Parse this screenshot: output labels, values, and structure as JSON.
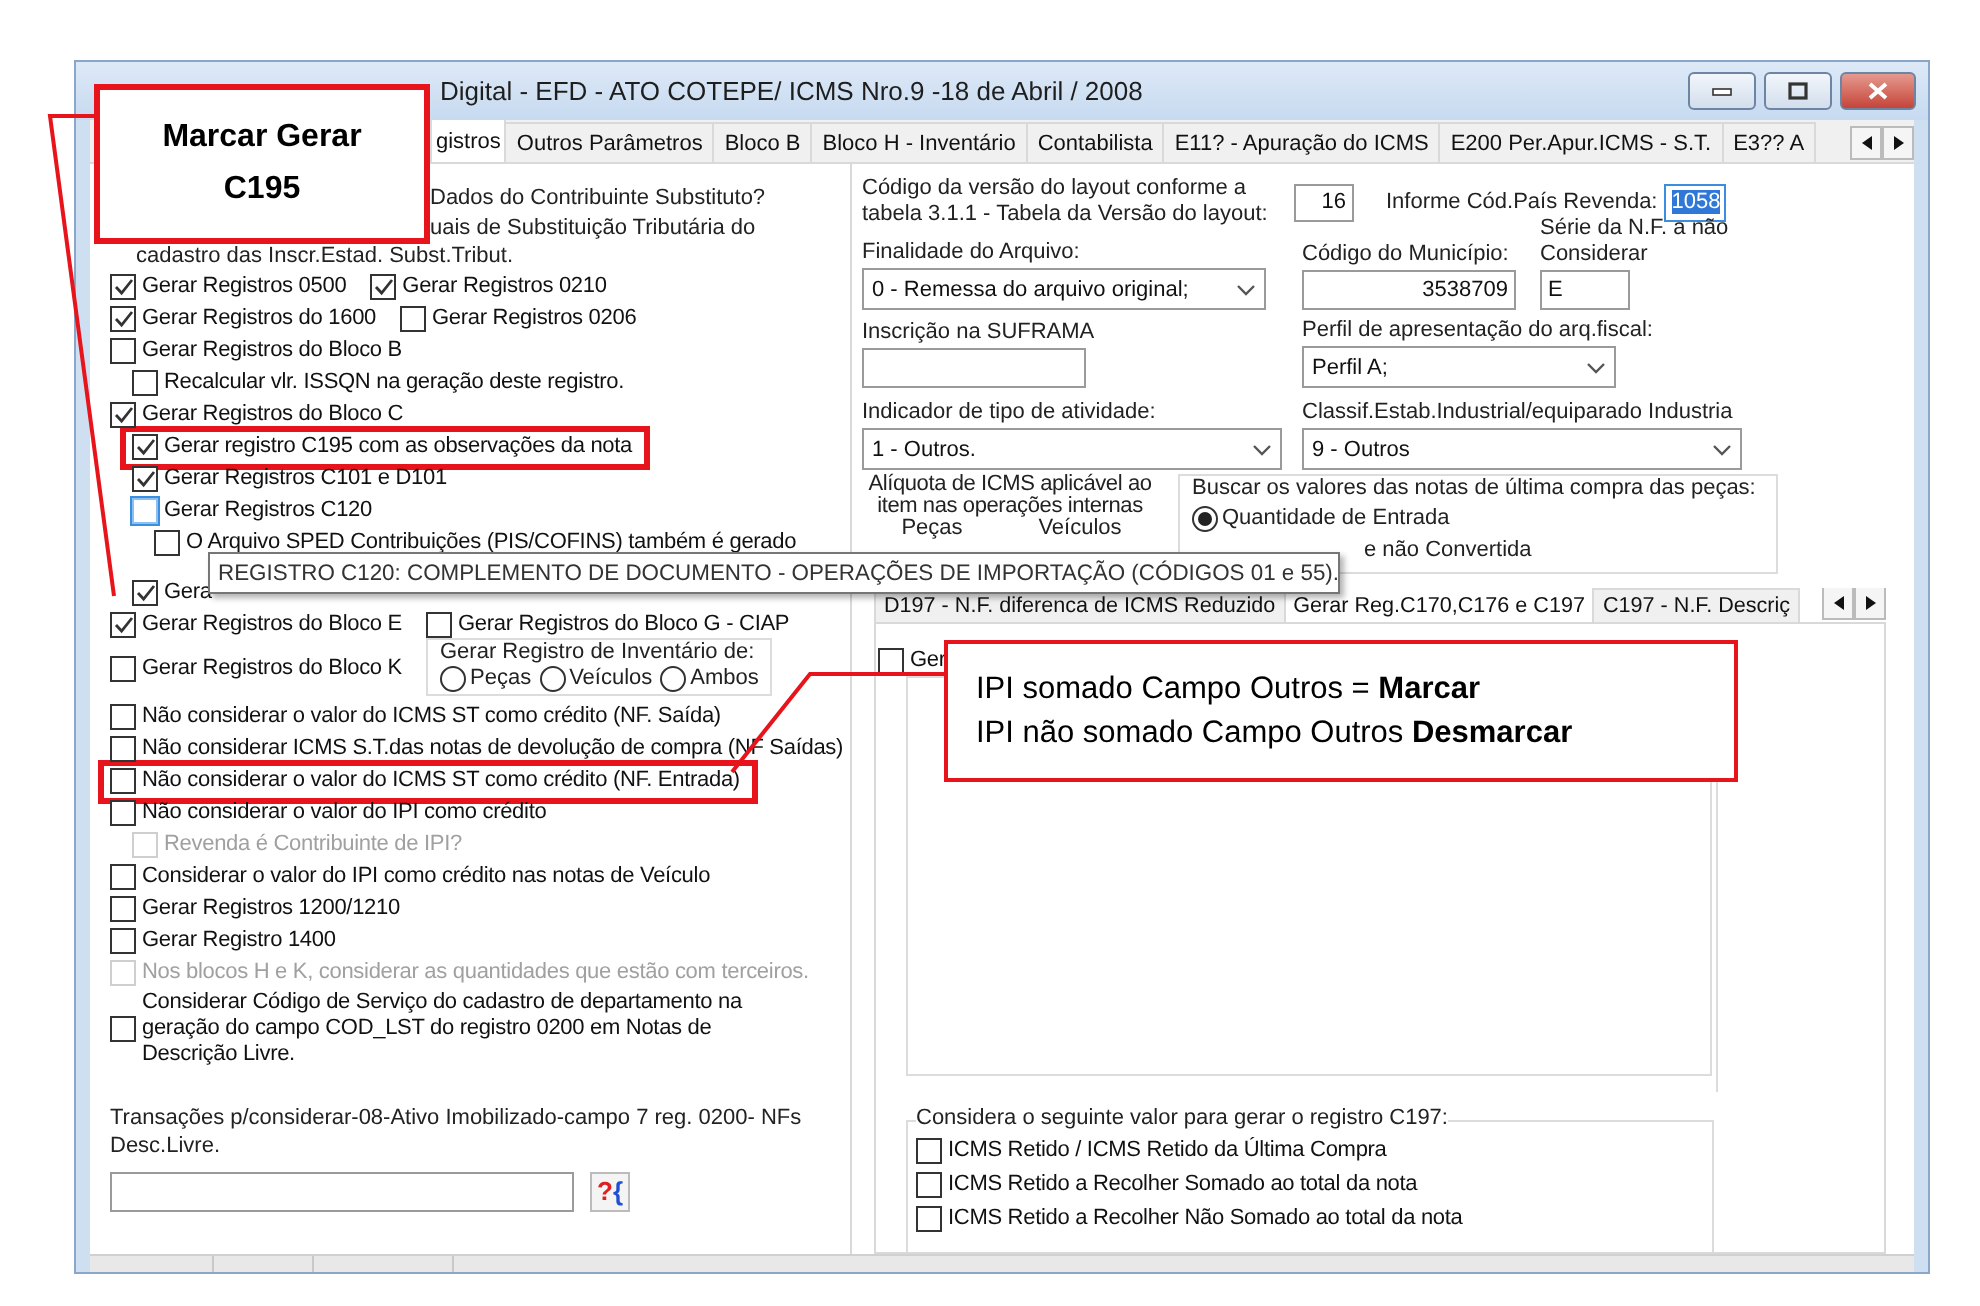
{
  "window": {
    "title": "Digital - EFD - ATO COTEPE/ ICMS Nro.9 -18 de Abril / 2008"
  },
  "tabs": [
    {
      "label": "gistros",
      "selected": true
    },
    {
      "label": "Outros Parâmetros",
      "selected": false
    },
    {
      "label": "Bloco B",
      "selected": false
    },
    {
      "label": "Bloco H - Inventário",
      "selected": false
    },
    {
      "label": "Contabilista",
      "selected": false
    },
    {
      "label": "E11? - Apuração  do ICMS",
      "selected": false
    },
    {
      "label": "E200 Per.Apur.ICMS - S.T.",
      "selected": false
    },
    {
      "label": "E3?? A",
      "selected": false
    }
  ],
  "intro_lines": [
    "Dados do Contribuinte Substituto?",
    "uais de Substituição Tributária do",
    "cadastro das Inscr.Estad. Subst.Tribut."
  ],
  "options": [
    {
      "kind": "pair",
      "items": [
        {
          "kind": "checkbox",
          "label": "Gerar Registros 0500",
          "checked": true,
          "disabled": false,
          "focused": false,
          "highlighted": false
        },
        {
          "kind": "checkbox",
          "label": "Gerar Registros 0210",
          "checked": true,
          "disabled": false,
          "focused": false,
          "highlighted": false
        }
      ]
    },
    {
      "kind": "pair",
      "items": [
        {
          "kind": "checkbox",
          "label": "Gerar Registros do 1600",
          "checked": true,
          "disabled": false,
          "focused": false,
          "highlighted": false
        },
        {
          "kind": "checkbox",
          "label": "Gerar Registros 0206",
          "checked": false,
          "disabled": false,
          "focused": false,
          "highlighted": false
        }
      ]
    },
    {
      "kind": "checkbox",
      "label": "Gerar Registros do Bloco B",
      "checked": false,
      "disabled": false,
      "focused": false,
      "highlighted": false,
      "children": [
        {
          "kind": "checkbox",
          "label": "Recalcular vlr. ISSQN na geração deste registro.",
          "checked": false,
          "disabled": false,
          "focused": false,
          "highlighted": false
        }
      ]
    },
    {
      "kind": "checkbox",
      "label": "Gerar Registros do Bloco C",
      "checked": true,
      "disabled": false,
      "focused": false,
      "highlighted": false,
      "children": [
        {
          "kind": "checkbox",
          "label": "Gerar registro C195 com as observações da nota",
          "checked": true,
          "disabled": false,
          "focused": false,
          "highlighted": true
        },
        {
          "kind": "checkbox",
          "label": "Gerar Registros C101 e D101",
          "checked": true,
          "disabled": false,
          "focused": false,
          "highlighted": false
        },
        {
          "kind": "checkbox",
          "label": "Gerar Registros C120",
          "checked": false,
          "disabled": false,
          "focused": true,
          "highlighted": false,
          "children": [
            {
              "kind": "checkbox",
              "label": "O Arquivo SPED Contribuições (PIS/COFINS) também é gerado",
              "checked": false,
              "disabled": false,
              "focused": false,
              "highlighted": false
            }
          ]
        },
        {
          "kind": "checkbox",
          "label": "Gera",
          "checked": true,
          "disabled": false,
          "focused": false,
          "highlighted": false
        }
      ]
    },
    {
      "kind": "pair",
      "items": [
        {
          "kind": "checkbox",
          "label": "Gerar Registros do Bloco E",
          "checked": true,
          "disabled": false,
          "focused": false,
          "highlighted": false
        },
        {
          "kind": "checkbox",
          "label": "Gerar Registros do Bloco G - CIAP",
          "checked": false,
          "disabled": false,
          "focused": false,
          "highlighted": false
        }
      ]
    },
    {
      "kind": "pair",
      "items": [
        {
          "kind": "checkbox",
          "label": "Gerar Registros do Bloco K",
          "checked": false,
          "disabled": false,
          "focused": false,
          "highlighted": false
        },
        {
          "kind": "radio_group",
          "title": "Gerar Registro de Inventário de:",
          "options": [
            {
              "label": "Peças",
              "selected": false
            },
            {
              "label": "Veículos",
              "selected": false
            },
            {
              "label": "Ambos",
              "selected": false
            }
          ]
        }
      ]
    },
    {
      "kind": "checkbox",
      "label": "Não considerar o valor do ICMS ST como crédito (NF. Saída)",
      "checked": false,
      "disabled": false,
      "focused": false,
      "highlighted": false
    },
    {
      "kind": "checkbox",
      "label": "Não considerar ICMS S.T.das notas de devolução de compra (NF Saídas)",
      "checked": false,
      "disabled": false,
      "focused": false,
      "highlighted": false
    },
    {
      "kind": "checkbox",
      "label": "Não considerar o valor do ICMS ST como crédito (NF. Entrada)",
      "checked": false,
      "disabled": false,
      "focused": false,
      "highlighted": true
    },
    {
      "kind": "checkbox",
      "label": "Não considerar o valor do IPI como crédito",
      "checked": false,
      "disabled": false,
      "focused": false,
      "highlighted": false,
      "children": [
        {
          "kind": "checkbox",
          "label": "Revenda é Contribuinte de IPI?",
          "checked": false,
          "disabled": true,
          "focused": false,
          "highlighted": false
        }
      ]
    },
    {
      "kind": "checkbox",
      "label": "Considerar o valor do IPI como crédito nas notas de Veículo",
      "checked": false,
      "disabled": false,
      "focused": false,
      "highlighted": false
    },
    {
      "kind": "checkbox",
      "label": "Gerar Registros 1200/1210",
      "checked": false,
      "disabled": false,
      "focused": false,
      "highlighted": false
    },
    {
      "kind": "checkbox",
      "label": "Gerar Registro 1400",
      "checked": false,
      "disabled": false,
      "focused": false,
      "highlighted": false
    },
    {
      "kind": "checkbox",
      "label": "Nos blocos H e K, considerar as quantidades que estão com terceiros.",
      "checked": false,
      "disabled": true,
      "focused": false,
      "highlighted": false
    },
    {
      "kind": "checkbox",
      "label": "Considerar Código de Serviço do cadastro de departamento na geração do campo COD_LST do registro 0200 em Notas de Descrição Livre.",
      "checked": false,
      "disabled": false,
      "focused": false,
      "highlighted": false
    }
  ],
  "transactions": {
    "label": "Transações p/considerar-08-Ativo Imobilizado-campo 7 reg. 0200- NFs Desc.Livre.",
    "lookup_button": "?{"
  },
  "settings": {
    "layout_version": {
      "label": "Código da versão do layout conforme a tabela 3.1.1 - Tabela da Versão do layout:",
      "value": "16"
    },
    "country_code": {
      "label": "Informe Cód.País Revenda:",
      "value": "1058",
      "text_selected": true
    },
    "file_purpose": {
      "label": "Finalidade do Arquivo:",
      "value": "0 - Remessa do arquivo original;"
    },
    "municipality_code": {
      "label": "Código do Município:",
      "value": "3538709"
    },
    "invoice_series": {
      "label": "Série da N.F. a  não Considerar",
      "value": "E"
    },
    "suframa": {
      "label": "Inscrição na SUFRAMA"
    },
    "fiscal_profile": {
      "label": "Perfil de apresentação do arq.fiscal:",
      "value": "Perfil A;"
    },
    "activity_type": {
      "label": "Indicador de tipo de atividade:",
      "value": "1 - Outros."
    },
    "industrial_class": {
      "label": "Classif.Estab.Industrial/equiparado Industria",
      "value": "9 - Outros"
    },
    "icms_rate": {
      "label": "Alíquota de ICMS aplicável ao item nas operações internas",
      "columns": [
        "Peças",
        "Veículos"
      ]
    },
    "last_purchase": {
      "title": "Buscar os valores das notas de última compra das peças:",
      "options": [
        {
          "label": "Quantidade de Entrada",
          "selected": true
        }
      ],
      "partial_label": "e não Convertida"
    }
  },
  "inner_tabs": [
    {
      "label": "D197 - N.F. diferenca de ICMS Reduzido",
      "selected": false
    },
    {
      "label": "Gerar Reg.C170,C176 e C197",
      "selected": true
    },
    {
      "label": "C197 - N.F. Descriç",
      "selected": false
    }
  ],
  "inner_panel": {
    "checkbox": {
      "label": "Ger",
      "checked": false
    },
    "c197_group": {
      "title": "Considera o seguinte valor para gerar o registro C197:",
      "options": [
        {
          "label": "ICMS Retido / ICMS Retido da Última Compra",
          "checked": false
        },
        {
          "label": "ICMS Retido a Recolher Somado ao total da nota",
          "checked": false
        },
        {
          "label": "ICMS Retido a Recolher Não Somado ao total da nota",
          "checked": false
        }
      ]
    }
  },
  "tooltip": {
    "text": "REGISTRO C120: COMPLEMENTO DE DOCUMENTO - OPERAÇÕES DE IMPORTAÇÃO (CÓDIGOS 01 e 55)."
  },
  "callouts": [
    {
      "kind": "title",
      "lines": [
        "Marcar Gerar C195"
      ]
    },
    {
      "kind": "note",
      "lines": [
        "IPI somado Campo Outros = **Marcar**",
        "IPI não somado Campo Outros **Desmarcar**"
      ]
    }
  ]
}
